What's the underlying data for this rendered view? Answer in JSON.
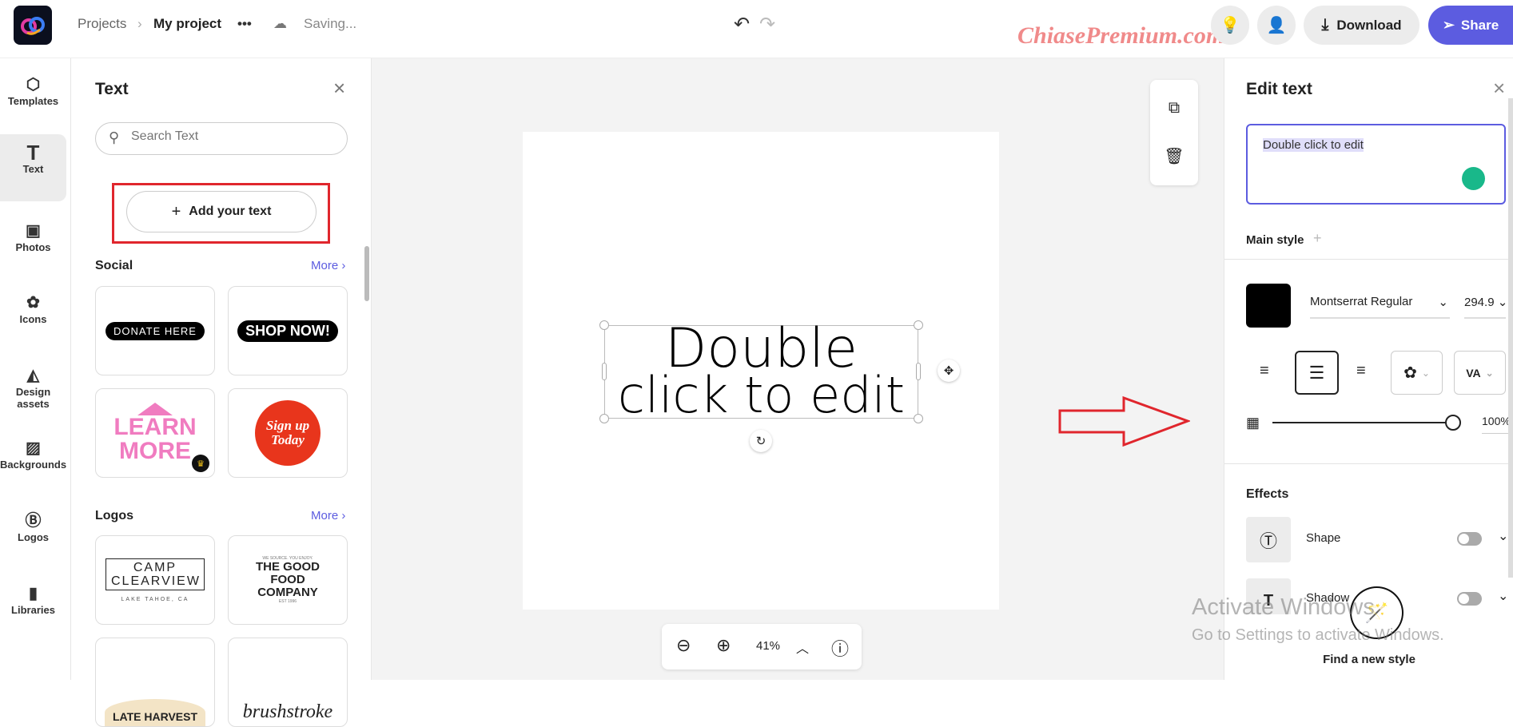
{
  "header": {
    "breadcrumb_root": "Projects",
    "project_name": "My project",
    "more": "•••",
    "status": "Saving...",
    "download": "Download",
    "share": "Share",
    "watermark": "ChiasePremium.com"
  },
  "colors": {
    "accent": "#5c5ce0",
    "share_bg": "#5c5ce0",
    "highlight": "#e0defa",
    "red_annotation": "#e0262d",
    "toggle_off": "#aaaaaa",
    "grammar_icon": "#19b88a"
  },
  "rail": [
    {
      "label": "Templates",
      "icon": "templates-icon"
    },
    {
      "label": "Text",
      "icon": "text-icon"
    },
    {
      "label": "Photos",
      "icon": "photos-icon"
    },
    {
      "label": "Icons",
      "icon": "icons-icon"
    },
    {
      "label": "Design assets",
      "icon": "design-assets-icon"
    },
    {
      "label": "Backgrounds",
      "icon": "backgrounds-icon"
    },
    {
      "label": "Logos",
      "icon": "logos-icon"
    },
    {
      "label": "Libraries",
      "icon": "libraries-icon"
    }
  ],
  "text_panel": {
    "title": "Text",
    "search_placeholder": "Search Text",
    "add_button": "Add your text",
    "sections": [
      {
        "title": "Social",
        "more": "More",
        "items": [
          "DONATE HERE",
          "SHOP NOW!",
          "LEARN MORE",
          "Sign up Today"
        ]
      },
      {
        "title": "Logos",
        "more": "More",
        "items": [
          "CAMP CLEARVIEW",
          "THE GOOD FOOD COMPANY",
          "LATE HARVEST",
          "brushstroke"
        ]
      }
    ],
    "logo_sub": {
      "camp": "LAKE TAHOE, CA",
      "food_top": "WE SOURCE. YOU ENJOY.",
      "food_bottom": "EST 1996"
    }
  },
  "canvas": {
    "text_line1": "Double",
    "text_line2": "click to edit",
    "zoom": "41%"
  },
  "edit_panel": {
    "title": "Edit text",
    "content": "Double click to edit",
    "main_style": "Main style",
    "font": "Montserrat Regular",
    "font_size": "294.9",
    "color": "#000000",
    "alignment": "center",
    "opacity_percent": 100,
    "opacity_label": "100%",
    "effects_title": "Effects",
    "effects": [
      {
        "label": "Shape",
        "enabled": false
      },
      {
        "label": "Shadow",
        "enabled": false
      }
    ],
    "find_style": "Find a new style"
  },
  "os_watermark": {
    "line1": "Activate Windows",
    "line2": "Go to Settings to activate Windows."
  }
}
